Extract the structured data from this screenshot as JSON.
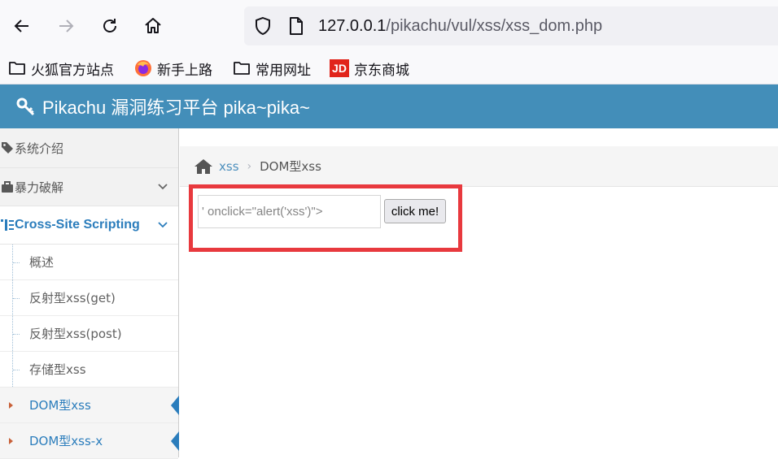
{
  "browser": {
    "url_host": "127.0.0.1",
    "url_path": "/pikachu/vul/xss/xss_dom.php",
    "bookmarks": [
      {
        "label": "火狐官方站点",
        "icon": "folder-icon"
      },
      {
        "label": "新手上路",
        "icon": "firefox-icon"
      },
      {
        "label": "常用网址",
        "icon": "folder-icon"
      },
      {
        "label": "京东商城",
        "icon": "jd-icon",
        "badge": "JD"
      }
    ]
  },
  "site": {
    "title": "Pikachu 漏洞练习平台 pika~pika~",
    "header_color": "#438eb9"
  },
  "sidebar": {
    "items": [
      {
        "label": "系统介绍",
        "icon": "tag-icon"
      },
      {
        "label": "暴力破解",
        "icon": "lock-icon"
      },
      {
        "label": "Cross-Site Scripting",
        "icon": "list-icon"
      }
    ],
    "subitems": [
      {
        "label": "概述"
      },
      {
        "label": "反射型xss(get)"
      },
      {
        "label": "反射型xss(post)"
      },
      {
        "label": "存储型xss"
      },
      {
        "label": "DOM型xss"
      },
      {
        "label": "DOM型xss-x"
      }
    ]
  },
  "breadcrumb": {
    "link": "xss",
    "separator": "›",
    "current": "DOM型xss"
  },
  "form": {
    "input_value": "' onclick=\"alert('xss')\">",
    "button_label": "click me!"
  },
  "colors": {
    "accent": "#2b7dbc",
    "highlight": "#e8393e"
  }
}
